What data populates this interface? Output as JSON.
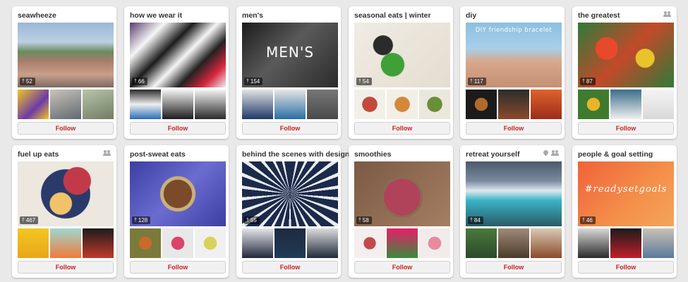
{
  "boards": [
    {
      "title": "seawheeze",
      "pin_count": "52",
      "follow_label": "Follow",
      "icons": [],
      "main_bg": "linear-gradient(180deg,#9bb7d6 0%,#bcd0e3 30%,#6b8a5c 45%,#a97d6b 60%,#c9a08c 80%,#7c6a60 100%)",
      "thumbs": [
        "linear-gradient(135deg,#f3c621 0%,#6d3aa8 60%,#f3c621 100%)",
        "linear-gradient(160deg,#c9c3b7,#5f6a73)",
        "linear-gradient(160deg,#b7c5a9,#707c63)"
      ]
    },
    {
      "title": "how we wear it",
      "pin_count": "66",
      "follow_label": "Follow",
      "icons": [],
      "main_bg": "linear-gradient(135deg,#5a3d6b 0%,#f5f5f5 22%,#1c1c1c 40%,#f5f5f5 55%,#222 70%,#d7263d 85%,#f0f0f0 100%)",
      "thumbs": [
        "linear-gradient(180deg,#2b2b2b,#eee 50%,#2a6cb8)",
        "linear-gradient(180deg,#f4f4f4,#1c1c1c)",
        "linear-gradient(180deg,#f4f4f4,#2a2a2a)"
      ]
    },
    {
      "title": "men's",
      "pin_count": "154",
      "follow_label": "Follow",
      "icons": [],
      "overlay_text": "MEN'S",
      "main_bg": "linear-gradient(135deg,#1c1c1c 0%,#5a5a5a 45%,#2b2b2b 100%)",
      "thumbs": [
        "linear-gradient(180deg,#e3e3e3,#1f3a66)",
        "linear-gradient(180deg,#e5e5e5,#2b6ea4)",
        "linear-gradient(180deg,#777,#4a4a4a)"
      ]
    },
    {
      "title": "seasonal eats | winter",
      "pin_count": "54",
      "follow_label": "Follow",
      "icons": [],
      "main_bg": "radial-gradient(circle at 40% 65%,#3fa037 0 16%,transparent 17%),radial-gradient(circle at 30% 35%,#2b2b2b 0 12%,transparent 13%),linear-gradient(135deg,#f0ece4,#e4ddd0)",
      "thumbs": [
        "radial-gradient(circle,#c24a3a 0 35%,#f2efe9 36%)",
        "radial-gradient(circle,#d5883a 0 35%,#f3efe6 36%)",
        "radial-gradient(circle,#6a8f3a 0 35%,#ece7dc 36%)"
      ]
    },
    {
      "title": "diy",
      "pin_count": "117",
      "follow_label": "Follow",
      "icons": [],
      "overlay_text": "DIY friendship bracelet",
      "overlay_class": "small",
      "main_bg": "linear-gradient(180deg,#8dbfe0 0%,#a7cfe9 40%,#d8a88c 60%,#c49074 100%)",
      "thumbs": [
        "radial-gradient(circle,#b06a2a 0 30%,#1b1b1b 31%)",
        "linear-gradient(180deg,#2c2c2c,#8a4b2c)",
        "linear-gradient(180deg,#e0622c,#9b2d1a)"
      ]
    },
    {
      "title": "the greatest",
      "pin_count": "87",
      "follow_label": "Follow",
      "icons": [
        "group-icon"
      ],
      "main_bg": "radial-gradient(circle at 30% 40%,#e8492a 0 14%,transparent 15%),radial-gradient(circle at 70% 55%,#e8c32a 0 12%,transparent 13%),linear-gradient(135deg,#2f7a3a,#c24a2a 50%,#2f7a3a)",
      "thumbs": [
        "radial-gradient(circle,#e8b42a 0 30%,#3f7b2f 31%)",
        "linear-gradient(180deg,#3b6e8a,#f0f0f0)",
        "linear-gradient(180deg,#f4f4f4,#d9d9d9)"
      ]
    },
    {
      "title": "fuel up eats",
      "pin_count": "467",
      "follow_label": "Follow",
      "icons": [
        "group-icon"
      ],
      "main_bg": "radial-gradient(circle at 62% 30%,#c23a4a 0 18%,transparent 19%),radial-gradient(circle at 45% 65%,#f1c26a 0 16%,transparent 17%),radial-gradient(circle at 50% 50%,#2a3a6b 0 42%,#ece7df 43%)",
      "thumbs": [
        "linear-gradient(180deg,#f3c621,#e8a61a)",
        "linear-gradient(180deg,#9fd7d0,#f07a3a)",
        "linear-gradient(180deg,#1c1c1c,#c23a2a)"
      ]
    },
    {
      "title": "post-sweat eats",
      "pin_count": "128",
      "follow_label": "Follow",
      "icons": [],
      "main_bg": "radial-gradient(circle at 50% 50%,#7a4a2a 0 24%,#c9b07a 25% 30%,transparent 31%),linear-gradient(135deg,#3d3ea3,#6b6cd0 50%,#3d3ea3)",
      "thumbs": [
        "radial-gradient(circle,#c86a2a 0 30%,#7a7a3a 31%)",
        "radial-gradient(circle,#d9466a 0 30%,#e8e8e8 31%)",
        "radial-gradient(circle,#d8d25a 0 30%,#f0f0f0 31%)"
      ]
    },
    {
      "title": "behind the scenes with design",
      "pin_count": "55",
      "follow_label": "Follow",
      "icons": [],
      "main_bg": "repeating-conic-gradient(from 0deg at 50% 50%,#1c2a4a 0deg 10deg,#e8ecf2 10deg 14deg)",
      "thumbs": [
        "linear-gradient(180deg,#e4e6ea,#23263a)",
        "linear-gradient(180deg,#1b2a40,#243a55)",
        "linear-gradient(180deg,#dcdcdc,#202a3a)"
      ]
    },
    {
      "title": "smoothies",
      "pin_count": "58",
      "follow_label": "Follow",
      "icons": [],
      "main_bg": "radial-gradient(circle at 50% 55%,#b0425a 0 30%,#8a6a52 31% 34%,transparent 35%),linear-gradient(135deg,#7a5a45,#a57e62)",
      "thumbs": [
        "radial-gradient(circle,#c24a4a 0 28%,#f4eeee 29%)",
        "linear-gradient(180deg,#e61f6a,#3a8a3a)",
        "radial-gradient(circle,#e88aa0 0 30%,#f1ecea 31%)"
      ]
    },
    {
      "title": "retreat yourself",
      "pin_count": "84",
      "follow_label": "Follow",
      "icons": [
        "location-pin-icon",
        "group-icon"
      ],
      "main_bg": "linear-gradient(180deg,#4a5a6a 0%,#7a8aa0 30%,#e0e8ec 45%,#3ab3c6 60%,#2a5a66 100%)",
      "thumbs": [
        "linear-gradient(180deg,#4a7a3a,#2a4a2a)",
        "linear-gradient(180deg,#a08a7a,#4a3a2a)",
        "linear-gradient(180deg,#d8c8b4,#8a4a2a)"
      ]
    },
    {
      "title": "people & goal setting",
      "pin_count": "46",
      "follow_label": "Follow",
      "icons": [],
      "overlay_text": "#readysetgoals",
      "overlay_class": "script",
      "main_bg": "linear-gradient(135deg,#f0623a 0%,#f4904a 60%,#f3a45a 100%)",
      "thumbs": [
        "linear-gradient(180deg,#d8d8d8,#2a2a2a)",
        "linear-gradient(180deg,#1b1b1b,#c21f2a)",
        "linear-gradient(180deg,#c9c0b4,#5a7a9a)"
      ]
    }
  ]
}
